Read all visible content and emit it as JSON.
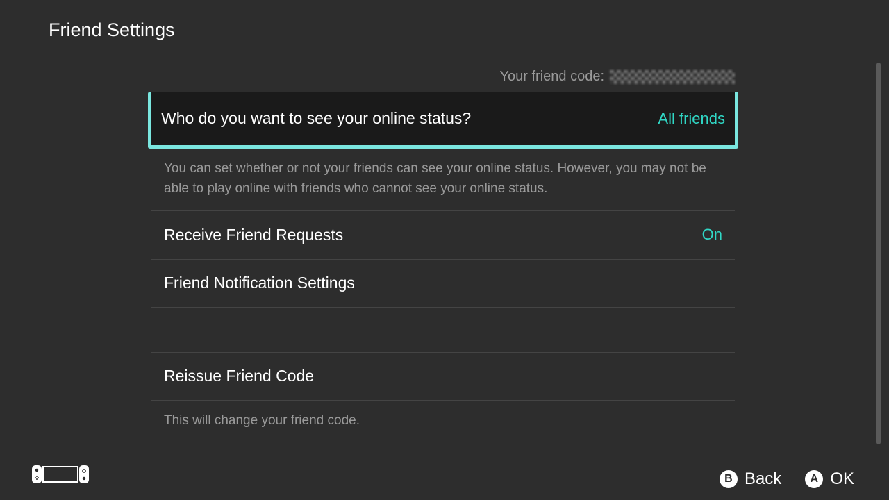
{
  "header": {
    "title": "Friend Settings"
  },
  "friend_code": {
    "label": "Your friend code:"
  },
  "settings": {
    "online_status": {
      "label": "Who do you want to see your online status?",
      "value": "All friends",
      "description": "You can set whether or not your friends can see your online status. However, you may not be able to play online with friends who cannot see your online status."
    },
    "receive_requests": {
      "label": "Receive Friend Requests",
      "value": "On"
    },
    "notifications": {
      "label": "Friend Notification Settings"
    },
    "reissue": {
      "label": "Reissue Friend Code",
      "description": "This will change your friend code."
    }
  },
  "footer": {
    "back": {
      "glyph": "B",
      "label": "Back"
    },
    "ok": {
      "glyph": "A",
      "label": "OK"
    }
  }
}
